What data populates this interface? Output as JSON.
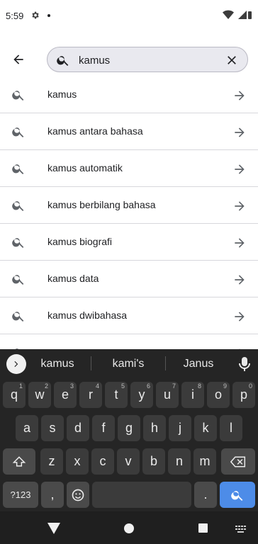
{
  "status_bar": {
    "time": "5:59",
    "icons": [
      "gear-icon",
      "notification-dot",
      "wifi-icon",
      "battery-icon"
    ]
  },
  "toolbar": {
    "back_icon": "arrow-left-icon"
  },
  "search": {
    "value": "kamus",
    "placeholder": ""
  },
  "suggestions": [
    {
      "label": "kamus"
    },
    {
      "label": "kamus antara bahasa"
    },
    {
      "label": "kamus automatik"
    },
    {
      "label": "kamus berbilang bahasa"
    },
    {
      "label": "kamus biografi"
    },
    {
      "label": "kamus data"
    },
    {
      "label": "kamus dwibahasa"
    },
    {
      "label": ""
    }
  ],
  "keyboard": {
    "word_suggestions": [
      "kamus",
      "kami's",
      "Janus"
    ],
    "row1": [
      {
        "k": "q",
        "h": "1"
      },
      {
        "k": "w",
        "h": "2"
      },
      {
        "k": "e",
        "h": "3"
      },
      {
        "k": "r",
        "h": "4"
      },
      {
        "k": "t",
        "h": "5"
      },
      {
        "k": "y",
        "h": "6"
      },
      {
        "k": "u",
        "h": "7"
      },
      {
        "k": "i",
        "h": "8"
      },
      {
        "k": "o",
        "h": "9"
      },
      {
        "k": "p",
        "h": "0"
      }
    ],
    "row2": [
      "a",
      "s",
      "d",
      "f",
      "g",
      "h",
      "j",
      "k",
      "l"
    ],
    "row3": [
      "z",
      "x",
      "c",
      "v",
      "b",
      "n",
      "m"
    ],
    "symbols_label": "?123",
    "comma": ",",
    "period": ".",
    "colors": {
      "background": "#252525",
      "key": "#3b3b3b",
      "accent": "#4d8ce8"
    }
  },
  "nav_bar": {
    "icons": [
      "back-triangle-icon",
      "home-circle-icon",
      "recents-square-icon",
      "keyboard-switch-icon"
    ]
  }
}
